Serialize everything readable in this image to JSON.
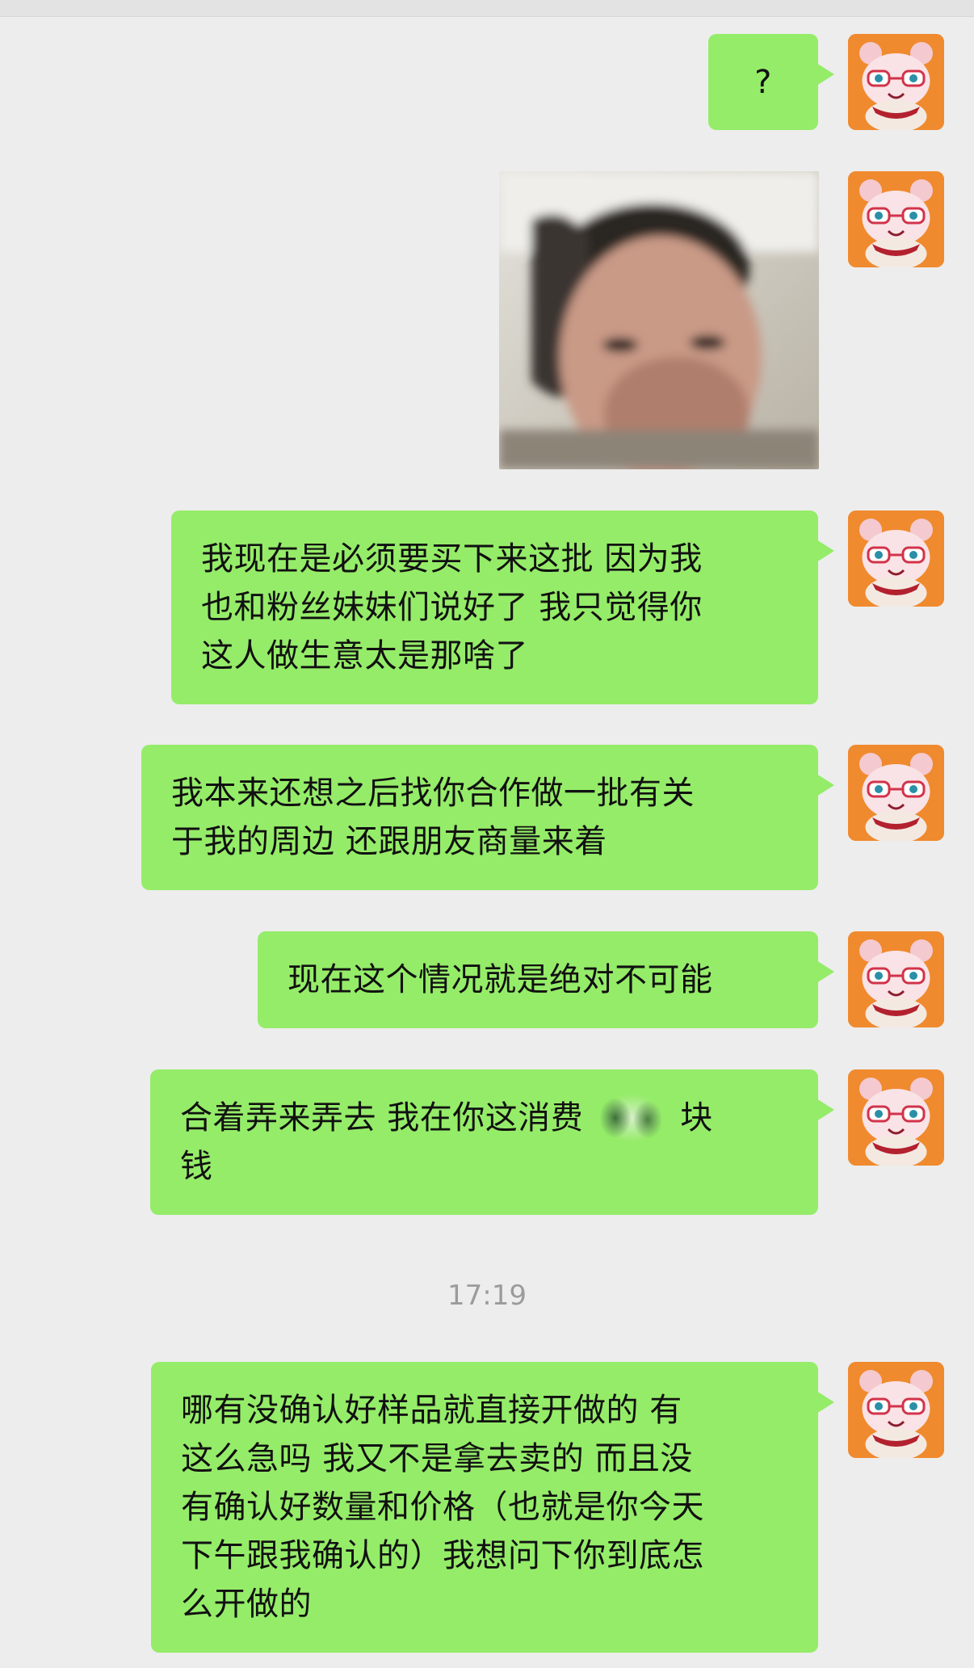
{
  "colors": {
    "background": "#ededed",
    "bubble": "#95ec69",
    "avatar_bg": "#f08a2e",
    "timestamp": "#9b9b9b"
  },
  "avatar": {
    "icon": "bear-with-glasses-avatar-icon"
  },
  "messages": [
    {
      "type": "text",
      "lines": [
        "?"
      ]
    },
    {
      "type": "image",
      "description_icon": "photo-thumbnail"
    },
    {
      "type": "text",
      "lines": [
        "我现在是必须要买下来这批 因为我",
        "也和粉丝妹妹们说好了 我只觉得你",
        "这人做生意太是那啥了"
      ]
    },
    {
      "type": "text",
      "lines": [
        "我本来还想之后找你合作做一批有关",
        "于我的周边 还跟朋友商量来着"
      ]
    },
    {
      "type": "text",
      "lines": [
        "现在这个情况就是绝对不可能"
      ]
    },
    {
      "type": "text",
      "line1_before": "合着弄来弄去 我在你这消费",
      "line1_after": "块",
      "line2": "钱"
    },
    {
      "type": "text",
      "lines": [
        "哪有没确认好样品就直接开做的 有",
        "这么急吗 我又不是拿去卖的 而且没",
        "有确认好数量和价格（也就是你今天",
        "下午跟我确认的）我想问下你到底怎",
        "么开做的"
      ]
    }
  ],
  "timestamp": "17:19"
}
